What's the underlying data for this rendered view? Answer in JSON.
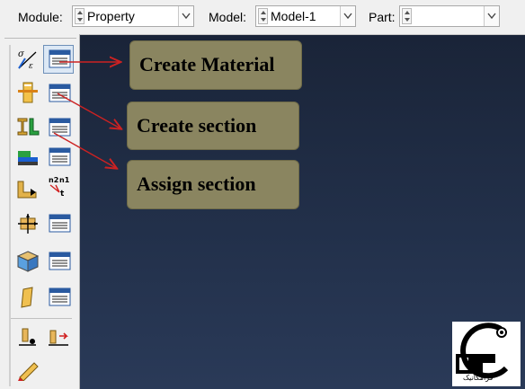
{
  "context_bar": {
    "module_label": "Module:",
    "module_value": "Property",
    "model_label": "Model:",
    "model_value": "Model-1",
    "part_label": "Part:",
    "part_value": ""
  },
  "callouts": {
    "create_material": "Create Material",
    "create_section": "Create section",
    "assign_section": "Assign section"
  },
  "toolbox": {
    "icons": [
      "material-icon",
      "material-manager-icon",
      "section-icon",
      "section-manager-icon",
      "profile-icon",
      "profile-manager-icon",
      "composite-layup-icon",
      "composite-manager-icon",
      "assign-section-icon",
      "assign-orientation-icon",
      "skin-icon",
      "skin-manager-icon",
      "special-icon",
      "special-manager-icon",
      "stringer-icon",
      "stringer-manager-icon",
      "inertia-icon",
      "inertia-manager-icon",
      "springs-icon",
      "query-icon"
    ]
  },
  "colors": {
    "viewport_top": "#1a2438",
    "viewport_bottom": "#2a3a58",
    "callout_fill": "#8a8560",
    "arrow": "#cc2222"
  },
  "watermark": {
    "text": "فرامکانیک"
  }
}
